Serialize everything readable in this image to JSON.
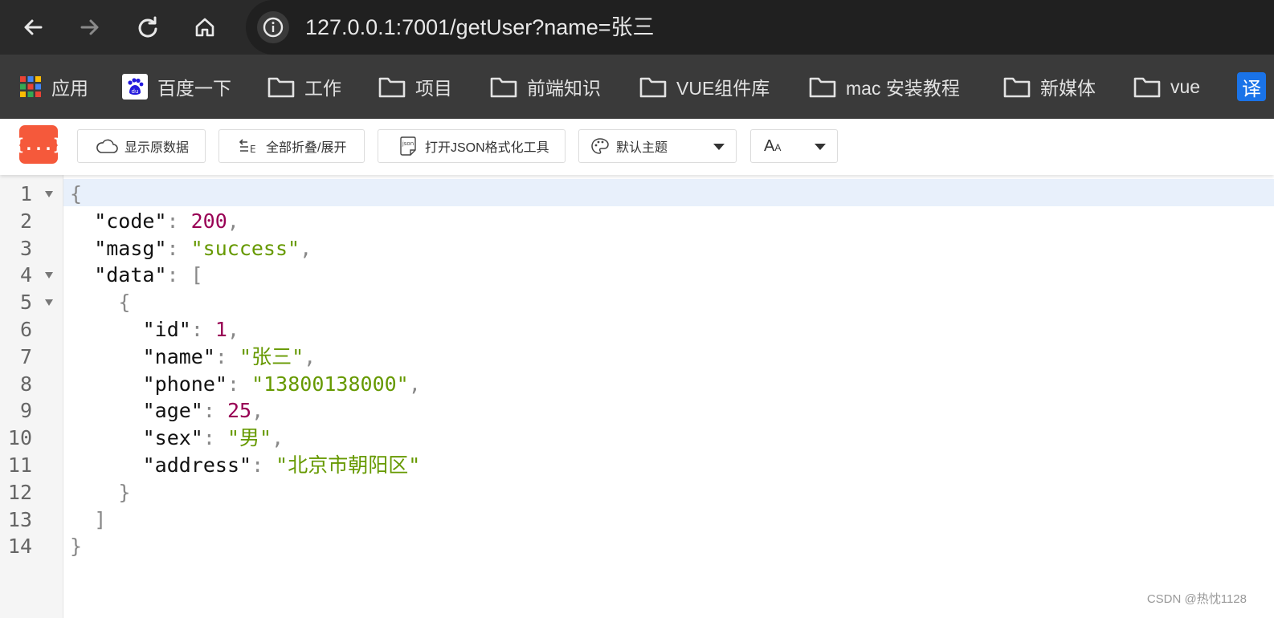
{
  "browser": {
    "url": "127.0.0.1:7001/getUser?name=张三"
  },
  "bookmarks": [
    {
      "label": "应用",
      "icon": "apps-grid-icon"
    },
    {
      "label": "百度一下",
      "icon": "baidu-icon"
    },
    {
      "label": "工作",
      "icon": "folder-icon"
    },
    {
      "label": "项目",
      "icon": "folder-icon"
    },
    {
      "label": "前端知识",
      "icon": "folder-icon"
    },
    {
      "label": "VUE组件库",
      "icon": "folder-icon"
    },
    {
      "label": "mac 安装教程",
      "icon": "folder-icon"
    },
    {
      "label": "新媒体",
      "icon": "folder-icon"
    },
    {
      "label": "vue",
      "icon": "folder-icon"
    },
    {
      "label": "译",
      "icon": "translate-icon"
    }
  ],
  "toolbar": {
    "logo": "{...}",
    "raw_label": "显示原数据",
    "fold_label": "全部折叠/展开",
    "tool_label": "打开JSON格式化工具",
    "json_icon_text": "json",
    "theme_label": "默认主题",
    "font_label": "A"
  },
  "json_lines": [
    {
      "n": "1",
      "fold": true,
      "indent": 0,
      "parts": [
        [
          "p",
          "{"
        ]
      ]
    },
    {
      "n": "2",
      "fold": false,
      "indent": 1,
      "parts": [
        [
          "k",
          "\"code\""
        ],
        [
          "p",
          ": "
        ],
        [
          "n",
          "200"
        ],
        [
          "p",
          ","
        ]
      ]
    },
    {
      "n": "3",
      "fold": false,
      "indent": 1,
      "parts": [
        [
          "k",
          "\"masg\""
        ],
        [
          "p",
          ": "
        ],
        [
          "s",
          "\"success\""
        ],
        [
          "p",
          ","
        ]
      ]
    },
    {
      "n": "4",
      "fold": true,
      "indent": 1,
      "parts": [
        [
          "k",
          "\"data\""
        ],
        [
          "p",
          ": ["
        ]
      ]
    },
    {
      "n": "5",
      "fold": true,
      "indent": 2,
      "parts": [
        [
          "p",
          "{"
        ]
      ]
    },
    {
      "n": "6",
      "fold": false,
      "indent": 3,
      "parts": [
        [
          "k",
          "\"id\""
        ],
        [
          "p",
          ": "
        ],
        [
          "n",
          "1"
        ],
        [
          "p",
          ","
        ]
      ]
    },
    {
      "n": "7",
      "fold": false,
      "indent": 3,
      "parts": [
        [
          "k",
          "\"name\""
        ],
        [
          "p",
          ": "
        ],
        [
          "s",
          "\"张三\""
        ],
        [
          "p",
          ","
        ]
      ]
    },
    {
      "n": "8",
      "fold": false,
      "indent": 3,
      "parts": [
        [
          "k",
          "\"phone\""
        ],
        [
          "p",
          ": "
        ],
        [
          "s",
          "\"13800138000\""
        ],
        [
          "p",
          ","
        ]
      ]
    },
    {
      "n": "9",
      "fold": false,
      "indent": 3,
      "parts": [
        [
          "k",
          "\"age\""
        ],
        [
          "p",
          ": "
        ],
        [
          "n",
          "25"
        ],
        [
          "p",
          ","
        ]
      ]
    },
    {
      "n": "10",
      "fold": false,
      "indent": 3,
      "parts": [
        [
          "k",
          "\"sex\""
        ],
        [
          "p",
          ": "
        ],
        [
          "s",
          "\"男\""
        ],
        [
          "p",
          ","
        ]
      ]
    },
    {
      "n": "11",
      "fold": false,
      "indent": 3,
      "parts": [
        [
          "k",
          "\"address\""
        ],
        [
          "p",
          ": "
        ],
        [
          "s",
          "\"北京市朝阳区\""
        ]
      ]
    },
    {
      "n": "12",
      "fold": false,
      "indent": 2,
      "parts": [
        [
          "p",
          "}"
        ]
      ]
    },
    {
      "n": "13",
      "fold": false,
      "indent": 1,
      "parts": [
        [
          "p",
          "]"
        ]
      ]
    },
    {
      "n": "14",
      "fold": false,
      "indent": 0,
      "parts": [
        [
          "p",
          "}"
        ]
      ]
    }
  ],
  "watermark": "CSDN @热忱1128"
}
